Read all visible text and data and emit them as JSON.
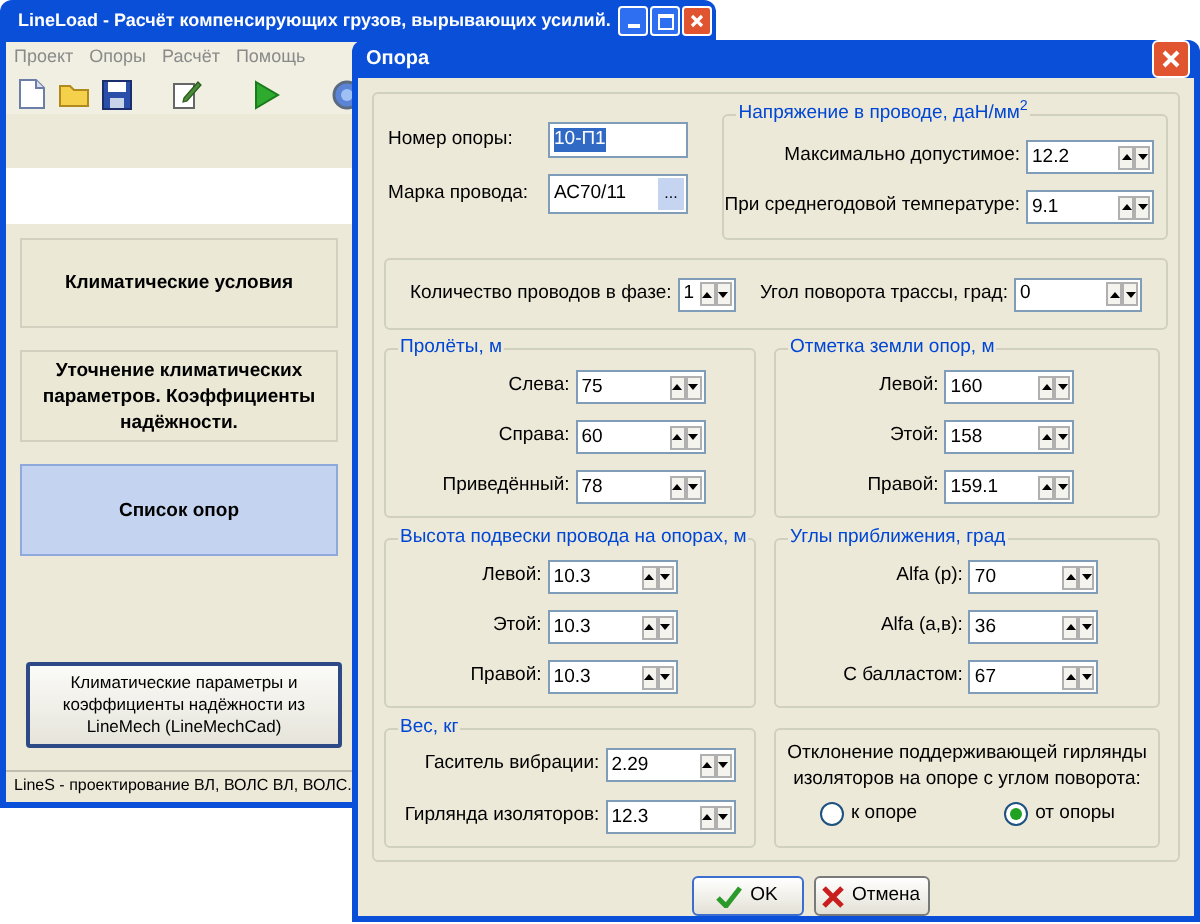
{
  "main_window": {
    "title": "LineLoad - Расчёт компенсирующих грузов, вырывающих усилий.",
    "menu": [
      "Проект",
      "Опоры",
      "Расчёт",
      "Помощь"
    ],
    "nav_buttons": [
      {
        "label": "Климатические условия",
        "selected": false
      },
      {
        "label": "Уточнение климатических параметров. Коэффициенты надёжности.",
        "selected": false
      },
      {
        "label": "Список опор",
        "selected": true
      }
    ],
    "import_button": "Климатические параметры и коэффициенты надёжности из LineMech (LineMechCad)",
    "status_bar": "LineS - проектирование ВЛ, ВОЛС ВЛ, ВОЛС."
  },
  "dialog": {
    "title": "Опора",
    "tower_number": {
      "label": "Номер опоры:",
      "value": "10-П1",
      "text_selected": true
    },
    "wire_brand": {
      "label": "Марка провода:",
      "value": "АС70/11",
      "button": "..."
    },
    "stress": {
      "title": "Напряжение в проводе,  даН/мм$^{2}$",
      "fields": [
        {
          "label": "Максимально допустимое:",
          "value": "12.2"
        },
        {
          "label": "При среднегодовой температуре:",
          "value": "9.1"
        }
      ]
    },
    "wires_per_phase": {
      "label": "Количество проводов в фазе:",
      "value": "1"
    },
    "route_angle": {
      "label": "Угол поворота трассы, град:",
      "value": "0"
    },
    "groups": [
      {
        "title": "Пролёты, м",
        "fields": [
          {
            "label": "Слева:",
            "value": "75"
          },
          {
            "label": "Справа:",
            "value": "60"
          },
          {
            "label": "Приведённый:",
            "value": "78"
          }
        ]
      },
      {
        "title": "Отметка земли опор, м",
        "fields": [
          {
            "label": "Левой:",
            "value": "160"
          },
          {
            "label": "Этой:",
            "value": "158"
          },
          {
            "label": "Правой:",
            "value": "159.1"
          }
        ]
      },
      {
        "title": "Высота подвески провода на опорах, м",
        "fields": [
          {
            "label": "Левой:",
            "value": "10.3"
          },
          {
            "label": "Этой:",
            "value": "10.3"
          },
          {
            "label": "Правой:",
            "value": "10.3"
          }
        ]
      },
      {
        "title": "Углы приближения, град",
        "fields": [
          {
            "label": "Alfa (р):",
            "value": "70"
          },
          {
            "label": "Alfa (а,в):",
            "value": "36"
          },
          {
            "label": "С балластом:",
            "value": "67"
          }
        ]
      }
    ],
    "weight": {
      "title": "Вес, кг",
      "fields": [
        {
          "label": "Гаситель вибрации:",
          "value": "2.29"
        },
        {
          "label": "Гирлянда изоляторов:",
          "value": "12.3"
        }
      ]
    },
    "deflection": {
      "text": "Отклонение поддерживающей гирлянды изоляторов на опоре с углом поворота:",
      "options": [
        {
          "label": "к опоре",
          "selected": false
        },
        {
          "label": "от опоры",
          "selected": true
        }
      ]
    },
    "buttons": [
      {
        "label": "OK",
        "kind": "ok"
      },
      {
        "label": "Отмена",
        "kind": "cancel"
      }
    ]
  }
}
